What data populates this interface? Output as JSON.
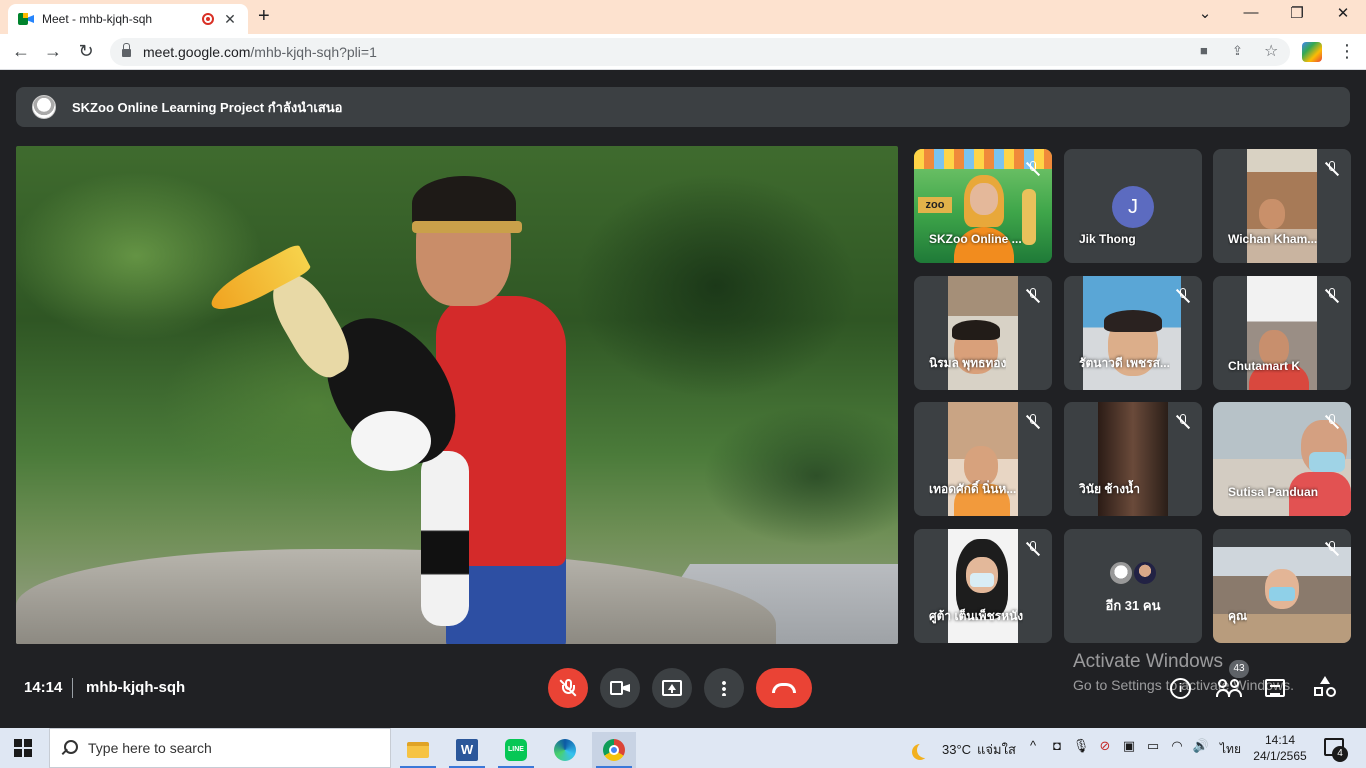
{
  "browser": {
    "tab_title": "Meet - mhb-kjqh-sqh",
    "tab_close": "✕",
    "new_tab": "+",
    "url_host": "meet.google.com",
    "url_rest": "/mhb-kjqh-sqh?pli=1",
    "win_min": "—",
    "win_max": "❐",
    "win_close": "✕",
    "chevron": "⌄"
  },
  "meet": {
    "presenting_text": "SKZoo Online Learning Project กำลังนำเสนอ",
    "tiles": [
      {
        "name": "SKZoo Online ...",
        "muted": true
      },
      {
        "name": "Jik Thong",
        "avatar_letter": "J",
        "muted": false
      },
      {
        "name": "Wichan Kham...",
        "muted": true
      },
      {
        "name": "นิรมล พุทธทอง",
        "muted": true
      },
      {
        "name": "รัตนาวดี เพชรส...",
        "muted": true
      },
      {
        "name": "Chutamart K",
        "muted": true
      },
      {
        "name": "เทอดศักดิ์ นิ่นห...",
        "muted": true
      },
      {
        "name": "วินัย ช้างน้ำ",
        "muted": true
      },
      {
        "name": "Sutisa Panduan",
        "muted": true
      },
      {
        "name": "ศูต้า เต็นเพ็ชรหนัง",
        "muted": true
      },
      {
        "name": "อีก 31 คน",
        "muted": false
      },
      {
        "name": "คุณ",
        "muted": true
      }
    ],
    "clock": "14:14",
    "meeting_code": "mhb-kjqh-sqh",
    "participant_count": "43",
    "watermark_title": "Activate Windows",
    "watermark_sub": "Go to Settings to activate Windows.",
    "info_glyph": "i",
    "colors": {
      "end_call": "#ea4335",
      "mic_off": "#ea4335",
      "bar": "#3c4043",
      "avatar_j": "#5c6bc0"
    }
  },
  "taskbar": {
    "search_placeholder": "Type here to search",
    "word_letter": "W",
    "line_label": "LINE",
    "temperature": "33°C",
    "weather_text": "แจ่มใส",
    "language": "ไทย",
    "time": "14:14",
    "date": "24/1/2565",
    "notification_count": "4"
  }
}
